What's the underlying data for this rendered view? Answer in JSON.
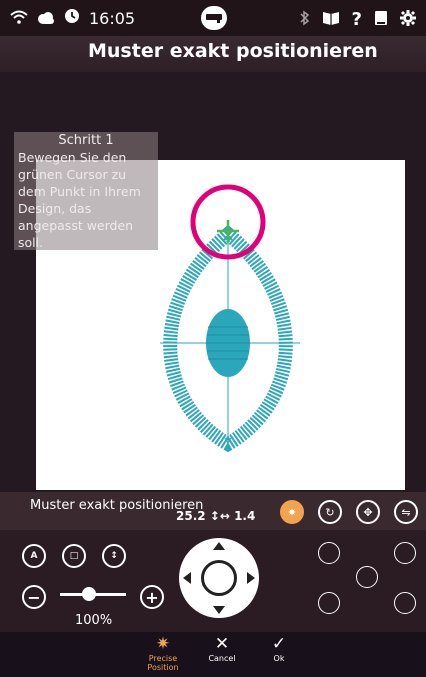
{
  "status": {
    "time": "16:05"
  },
  "header": {
    "title": "Muster exakt positionieren"
  },
  "tooltip": {
    "title": "Schritt 1",
    "text": "Bewegen Sie den grünen Cursor zu dem Punkt in Ihrem Design, das angepasst werden soll."
  },
  "toolbar": {
    "label": "Muster exakt positionieren",
    "coords": "25.2 ↕↔ 1.4"
  },
  "controls": {
    "zoom_percent": "100%"
  },
  "bottom": {
    "precise_label": "Precise Position",
    "cancel_label": "Cancel",
    "ok_label": "Ok"
  },
  "colors": {
    "accent": "#f1a44f",
    "highlight_ring": "#e0007a",
    "thread": "#2aa7bb",
    "cursor": "#4cb848"
  }
}
